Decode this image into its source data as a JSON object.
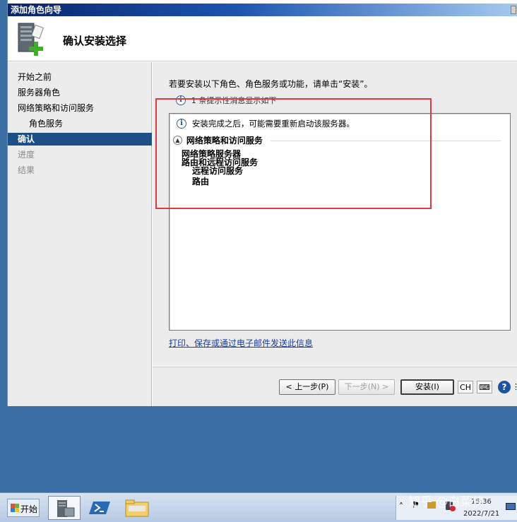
{
  "window": {
    "title": "添加角色向导",
    "page_title": "确认安装选择"
  },
  "nav": {
    "items": [
      {
        "label": "开始之前",
        "state": "normal"
      },
      {
        "label": "服务器角色",
        "state": "normal"
      },
      {
        "label": "网络策略和访问服务",
        "state": "normal"
      },
      {
        "label": "角色服务",
        "state": "normal"
      },
      {
        "label": "确认",
        "state": "current"
      },
      {
        "label": "进度",
        "state": "disabled"
      },
      {
        "label": "结果",
        "state": "disabled"
      }
    ]
  },
  "content": {
    "instruction": "若要安装以下角色、角色服务或功能，请单击“安装”。",
    "warning": "1 条提示性消息显示如下",
    "summary": {
      "info_message": "安装完成之后，可能需要重新启动该服务器。",
      "section_title": "网络策略和访问服务",
      "items": [
        "网络策略服务器",
        "路由和远程访问服务",
        "远程访问服务",
        "路由"
      ]
    },
    "print_link": "打印、保存或通过电子邮件发送此信息"
  },
  "buttons": {
    "previous": "< 上一步(P)",
    "next": "下一步(N) >",
    "install": "安装(I)"
  },
  "taskbar": {
    "start_label": "开始",
    "ime_label": "CH",
    "clock_time": "15:36",
    "clock_date": "2022/7/21"
  },
  "watermark": "知乎 @白菜侠",
  "colors": {
    "nav_selected": "#1c4f87",
    "highlight_border": "#e0393e",
    "desktop": "#3a6ea5",
    "link": "#1a3c9e"
  },
  "icons": {
    "header": "server-add-icon",
    "info": "info-icon",
    "collapse": "collapse-icon",
    "help": "help-icon"
  }
}
